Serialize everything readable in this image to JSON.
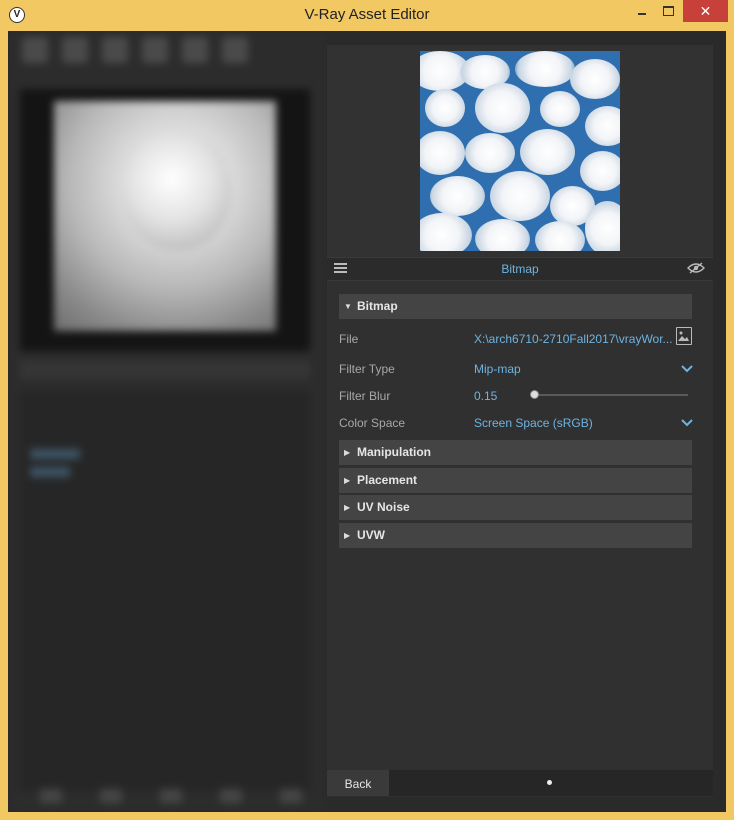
{
  "window": {
    "title": "V-Ray Asset Editor",
    "app_icon": "vray-logo-icon",
    "controls": {
      "minimize": "minimize-icon",
      "maximize": "maximize-icon",
      "close": "✕"
    }
  },
  "panel": {
    "header_title": "Bitmap",
    "icons": {
      "list": "list-icon",
      "visibility": "eye-hidden-icon"
    }
  },
  "bitmap_section": {
    "label": "Bitmap",
    "expanded": true,
    "params": {
      "file_label": "File",
      "file_value": "X:\\arch6710-2710Fall2017\\vrayWor...",
      "filter_type_label": "Filter Type",
      "filter_type_value": "Mip-map",
      "filter_blur_label": "Filter Blur",
      "filter_blur_value": "0.15",
      "color_space_label": "Color Space",
      "color_space_value": "Screen Space (sRGB)"
    }
  },
  "collapsed_sections": [
    {
      "label": "Manipulation"
    },
    {
      "label": "Placement"
    },
    {
      "label": "UV Noise"
    },
    {
      "label": "UVW"
    }
  ],
  "footer": {
    "back_label": "Back"
  },
  "colors": {
    "window_frame": "#f1c862",
    "accent": "#6fb3e0",
    "panel_bg": "#303030",
    "section_bg": "#444444",
    "close_button": "#c7403a"
  }
}
